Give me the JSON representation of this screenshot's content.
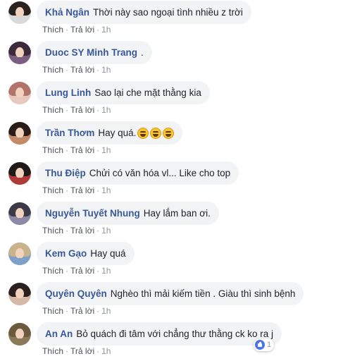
{
  "actions": {
    "like": "Thích",
    "reply": "Trả lời",
    "separator": "·"
  },
  "comments": [
    {
      "author": "Khả Ngân",
      "text": "Thời này sao ngoại tình nhiều z trời",
      "time": "1h",
      "avatar_hair": "#2b2220",
      "avatar_body": "#d9d9d9"
    },
    {
      "author": "Duoc SY Minh Trang",
      "text": ".",
      "time": "1h",
      "avatar_hair": "#3a2a3a",
      "avatar_body": "#7a5f80"
    },
    {
      "author": "Lung Linh",
      "text": "Sao lại che mặt thằng kia",
      "time": "1h",
      "avatar_hair": "#b2736a",
      "avatar_body": "#e8c9c0"
    },
    {
      "author": "Trần Thơm",
      "text": "Hay quá.",
      "time": "1h",
      "avatar_hair": "#2a1c18",
      "avatar_body": "#c48a6a",
      "emoji_count": 3
    },
    {
      "author": "Thu Điệp",
      "text": "Chửi có văn hóa vl... Like cho top",
      "time": "1h",
      "avatar_hair": "#1f1a1a",
      "avatar_body": "#b03a3a"
    },
    {
      "author": "Nguyễn Tuyết Nhung",
      "text": "Hay lắm ban ơi.",
      "time": "1h",
      "avatar_hair": "#3d3a48",
      "avatar_body": "#8c8aa6"
    },
    {
      "author": "Kem Gạo",
      "text": "Hay quá",
      "time": "1h",
      "avatar_hair": "#c8b38a",
      "avatar_body": "#7fa0c8"
    },
    {
      "author": "Quyên Quyên",
      "text": "Nghèo thì mải kiếm tiền . Giàu thì sinh bệnh",
      "time": "1h",
      "avatar_hair": "#2a2020",
      "avatar_body": "#d6b8a8"
    },
    {
      "author": "An An",
      "text": "Bỏ quách đi tâm với chẳng thư thằng ck ko ra j",
      "time": "1h",
      "avatar_hair": "#6b5a3e",
      "avatar_body": "#8a7a5a",
      "reactions": {
        "icon": "like-icon",
        "count": "1"
      }
    }
  ]
}
